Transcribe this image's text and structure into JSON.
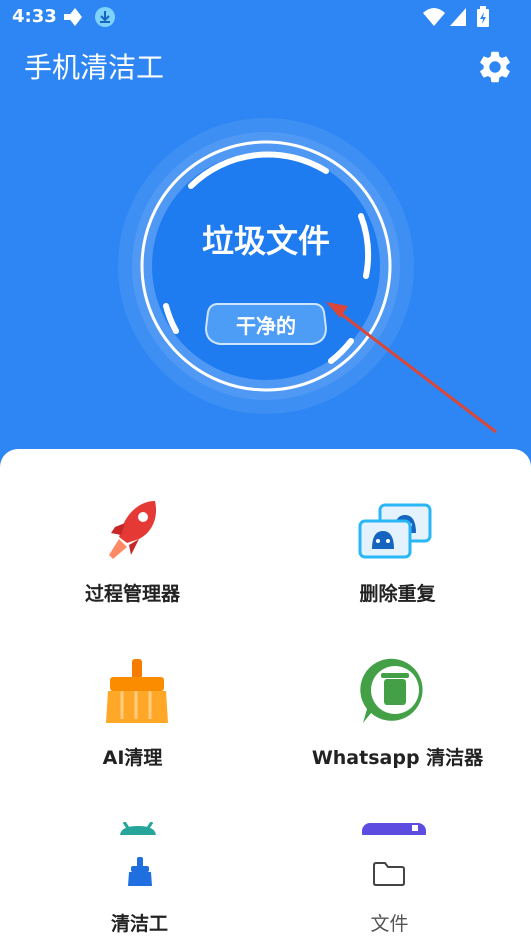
{
  "status_bar": {
    "time": "4:33",
    "icons": [
      "navigation-icon",
      "download-icon",
      "wifi-icon",
      "signal-icon",
      "battery-icon"
    ]
  },
  "header": {
    "title": "手机清洁工",
    "settings_icon": "gear-icon"
  },
  "gauge": {
    "title": "垃圾文件",
    "badge": "干净的"
  },
  "features": [
    {
      "label": "过程管理器",
      "icon": "rocket-icon"
    },
    {
      "label": "删除重复",
      "icon": "duplicate-photos-icon"
    },
    {
      "label": "AI清理",
      "icon": "broom-icon"
    },
    {
      "label": "Whatsapp 清洁器",
      "icon": "whatsapp-trash-icon"
    }
  ],
  "bottom_nav": [
    {
      "label": "清洁工",
      "icon": "broom-icon",
      "active": true
    },
    {
      "label": "文件",
      "icon": "folder-icon",
      "active": false
    }
  ],
  "colors": {
    "primary": "#2d86f3",
    "nav_active": "#222222",
    "nav_inactive": "#555555",
    "annotation_arrow": "#d9463a"
  }
}
